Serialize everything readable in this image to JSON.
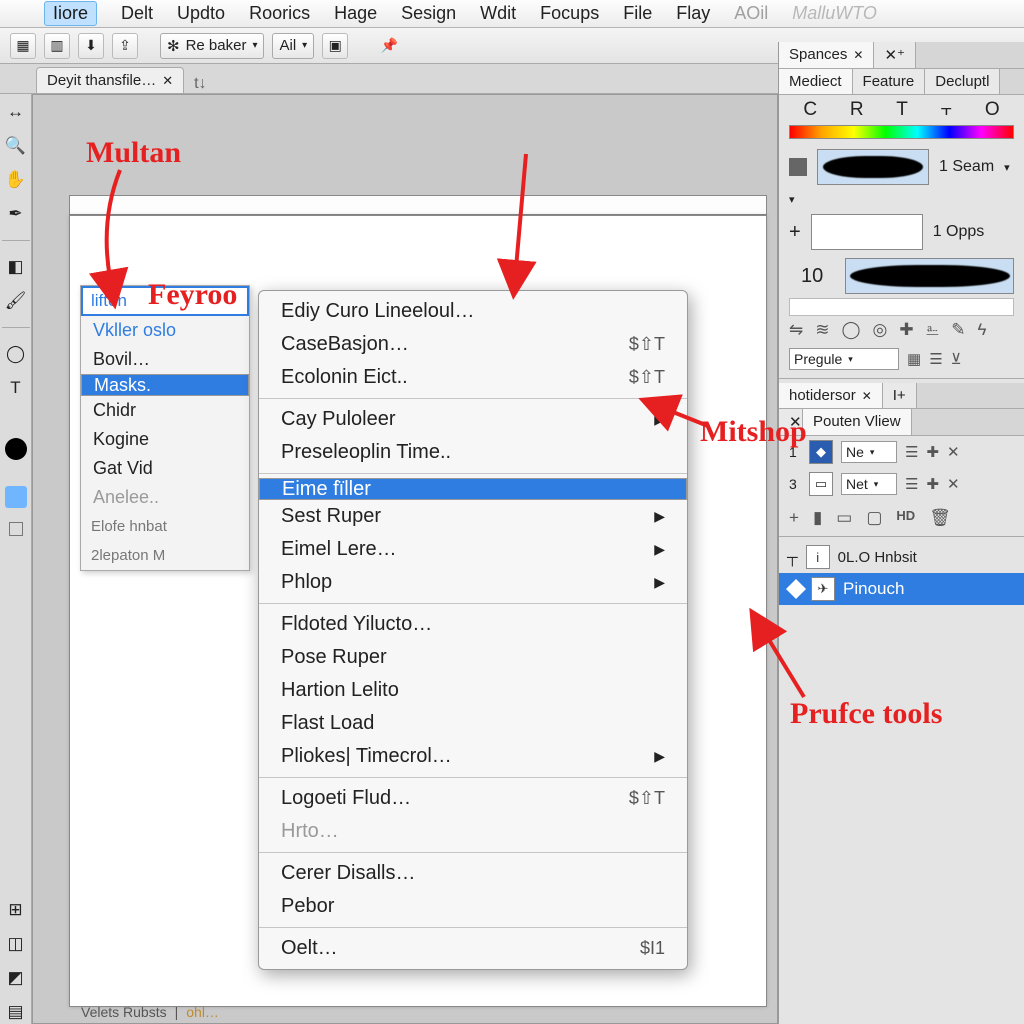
{
  "menubar": {
    "items": [
      "Iiore",
      "Delt",
      "Updto",
      "Roorics",
      "Hage",
      "Sesign",
      "Wdit",
      "Focups",
      "File",
      "Flay"
    ],
    "faded1": "AOil",
    "faded2": "MalluWTO"
  },
  "toolbar": {
    "drop1": "Re baker",
    "drop2": "Ail"
  },
  "doctab": {
    "title": "Deyit thansfile…",
    "extra": "t↓"
  },
  "sublist": {
    "header": "liften",
    "rows": [
      "Vkller oslo",
      "Bovil…",
      "Masks.",
      "Chidr",
      "Kogine",
      "Gat Vid",
      "Anelee.."
    ],
    "foot1": "Elofe hnbat",
    "foot2": "2lepaton M"
  },
  "ctx": {
    "g1": [
      {
        "label": "Ediy Curo Lineeloul…"
      },
      {
        "label": "CaseBasjon…",
        "sc": "$⇧T"
      },
      {
        "label": "Ecolonin Eict..",
        "sc": "$⇧T"
      }
    ],
    "g2": [
      {
        "label": "Cay Puloleer",
        "arr": true
      },
      {
        "label": "Preseleoplin Time.."
      }
    ],
    "g3": [
      {
        "label": "Eime fïller",
        "sel": true
      },
      {
        "label": "Sest Ruper",
        "arr": true
      },
      {
        "label": "Eimel Lere…",
        "arr": true
      },
      {
        "label": "Phlop",
        "arr": true
      }
    ],
    "g4": [
      {
        "label": "Fldoted Yilucto…"
      },
      {
        "label": "Pose Ruper"
      },
      {
        "label": "Hartion Lelito"
      },
      {
        "label": "Flast Load"
      },
      {
        "label": "Pliokes| Timecrol…",
        "arr": true
      }
    ],
    "g5": [
      {
        "label": "Logoeti Flud…",
        "sc": "$⇧T"
      },
      {
        "label": "Hrto…",
        "dim": true
      }
    ],
    "g6": [
      {
        "label": "Cerer Disalls…"
      },
      {
        "label": "Pebor"
      }
    ],
    "g7": [
      {
        "label": "Oelt…",
        "sc": "$I1"
      }
    ]
  },
  "dock": {
    "tabrow1": {
      "a": "Spances"
    },
    "tabrow2": {
      "a": "Mediect",
      "b": "Feature",
      "c": "Decluptl"
    },
    "crt": [
      "C",
      "R",
      "T",
      "⫟",
      "O"
    ],
    "brush1_label": "1 Seam",
    "brush2_label": "1 Opps",
    "ten": "10",
    "pregule": "Pregule",
    "tabrow3": {
      "a": "hotidersor",
      "b": "I+"
    },
    "tabrow4": {
      "b": "Pouten Vliew"
    },
    "ne": "Ne",
    "net": "Net",
    "row_nums": {
      "a": "1",
      "b": "3"
    },
    "hd": "HD",
    "hnbsit": "0L.O Hnbsit",
    "pinouch": "Pinouch"
  },
  "status": {
    "a": "Velets Rubsts",
    "b": "ohl…"
  },
  "anno": {
    "multan": "Multan",
    "feyroo": "Feyroo",
    "mitshop": "Mitshop",
    "prufce": "Prufce tools"
  }
}
